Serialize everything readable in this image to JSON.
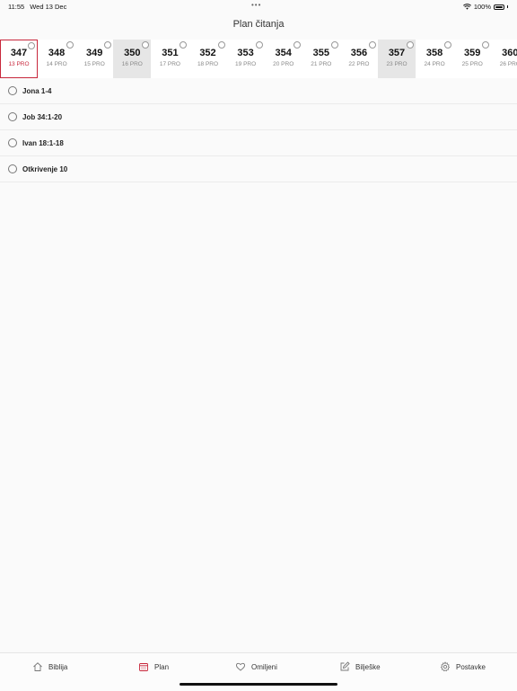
{
  "status_bar": {
    "time": "11:55",
    "date": "Wed 13 Dec",
    "battery": "100%"
  },
  "header": {
    "title": "Plan čitanja"
  },
  "day_strip": {
    "days": [
      {
        "num": "347",
        "date": "13 PRO",
        "selected": true,
        "shaded": false
      },
      {
        "num": "348",
        "date": "14 PRO",
        "selected": false,
        "shaded": false
      },
      {
        "num": "349",
        "date": "15 PRO",
        "selected": false,
        "shaded": false
      },
      {
        "num": "350",
        "date": "16 PRO",
        "selected": false,
        "shaded": true
      },
      {
        "num": "351",
        "date": "17 PRO",
        "selected": false,
        "shaded": false
      },
      {
        "num": "352",
        "date": "18 PRO",
        "selected": false,
        "shaded": false
      },
      {
        "num": "353",
        "date": "19 PRO",
        "selected": false,
        "shaded": false
      },
      {
        "num": "354",
        "date": "20 PRO",
        "selected": false,
        "shaded": false
      },
      {
        "num": "355",
        "date": "21 PRO",
        "selected": false,
        "shaded": false
      },
      {
        "num": "356",
        "date": "22 PRO",
        "selected": false,
        "shaded": false
      },
      {
        "num": "357",
        "date": "23 PRO",
        "selected": false,
        "shaded": true
      },
      {
        "num": "358",
        "date": "24 PRO",
        "selected": false,
        "shaded": false
      },
      {
        "num": "359",
        "date": "25 PRO",
        "selected": false,
        "shaded": false
      },
      {
        "num": "360",
        "date": "26 PRO",
        "selected": false,
        "shaded": false
      }
    ]
  },
  "readings": [
    {
      "label": "Jona 1-4"
    },
    {
      "label": "Job 34:1-20"
    },
    {
      "label": "Ivan 18:1-18"
    },
    {
      "label": "Otkrivenje 10"
    }
  ],
  "tab_bar": {
    "tabs": [
      {
        "label": "Biblija",
        "icon": "home-icon"
      },
      {
        "label": "Plan",
        "icon": "calendar-icon",
        "active": true
      },
      {
        "label": "Omiljeni",
        "icon": "heart-icon"
      },
      {
        "label": "Bilješke",
        "icon": "edit-icon"
      },
      {
        "label": "Postavke",
        "icon": "gear-icon"
      }
    ]
  },
  "colors": {
    "accent": "#c8283c",
    "shaded_day": "#e6e6e6",
    "background": "#fafafa"
  }
}
